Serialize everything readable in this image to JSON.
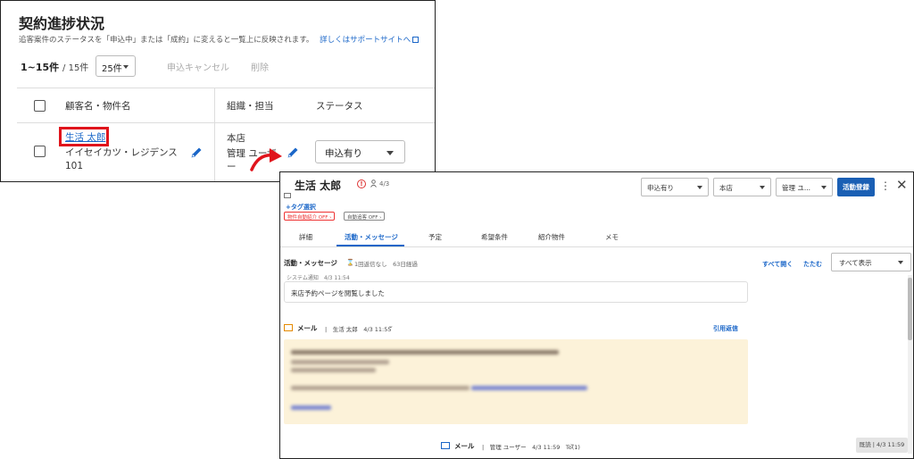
{
  "list_screen": {
    "title": "契約進捗状況",
    "description": "追客案件のステータスを「申込中」または「成約」に変えると一覧上に反映されます。",
    "description_link": "詳しくはサポートサイトへ",
    "count": "1~15件",
    "count_total": "/ 15件",
    "per_page": "25件",
    "cancel_label": "申込キャンセル",
    "delete_label": "削除",
    "columns": [
      "顧客名・物件名",
      "組織・担当",
      "ステータス"
    ],
    "row": {
      "customer_name": "生活 太郎",
      "property": "イイセイカツ・レジデンス 101",
      "branch": "本店",
      "staff": "管理 ユーザー",
      "status": "申込有り"
    }
  },
  "detail_screen": {
    "customer_name": "生活 太郎",
    "date": "4/3",
    "tag_select": "+タグ選択",
    "auto_intro_badge": "物件自動紹介 OFF ›",
    "auto_reply_badge": "自動追客 OFF ›",
    "status_select": "申込有り",
    "branch_select": "本店",
    "staff_select": "管理 ユ...",
    "register_button": "活動登録",
    "kebab": "⋮",
    "close": "✕",
    "tabs": [
      "詳細",
      "活動・メッセージ",
      "予定",
      "希望条件",
      "紹介物件",
      "メモ"
    ],
    "active_tab": 1,
    "section_title": "活動・メッセージ",
    "reply_info": "1回返信なし　63日経過",
    "expand_all": "すべて開く",
    "collapse": "たたむ",
    "filter_select": "すべて表示",
    "system_notice": "システム通知　4/3 11:54",
    "visit_message": "来店予約ページを閲覧しました",
    "mail1": {
      "label": "メール",
      "sender": "|　生活 太郎　4/3 11:55",
      "chevron": "⌄",
      "action": "引用返信"
    },
    "mail2": {
      "label": "メール",
      "sender": "|　管理 ユーザー　4/3 11:59　To(1)",
      "chevron": "⌄"
    },
    "read_badge": "既読 | 4/3 11:59"
  },
  "colors": {
    "highlight_red": "#e0141c",
    "link_blue": "#1a66c8",
    "primary_button": "#1a5fb4",
    "mail_body_bg": "#fcf2d9"
  }
}
